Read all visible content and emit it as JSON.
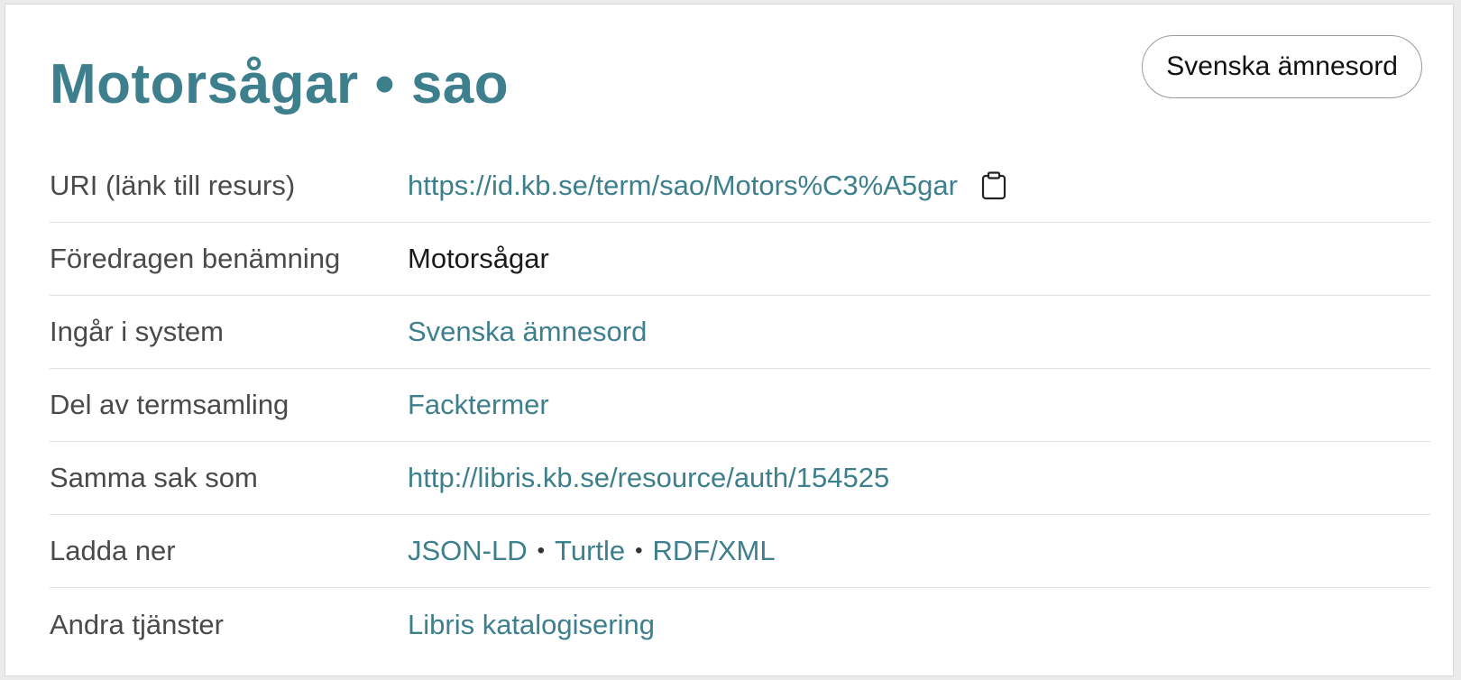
{
  "header": {
    "term": "Motorsågar",
    "separator": "•",
    "code": "sao",
    "scheme_button": "Svenska ämnesord"
  },
  "rows": [
    {
      "label": "URI (länk till resurs)",
      "value": "https://id.kb.se/term/sao/Motors%C3%A5gar",
      "icon": "clipboard-icon"
    },
    {
      "label": "Föredragen benämning",
      "value": "Motorsågar"
    },
    {
      "label": "Ingår i system",
      "value": "Svenska ämnesord"
    },
    {
      "label": "Del av termsamling",
      "value": "Facktermer"
    },
    {
      "label": "Samma sak som",
      "value": "http://libris.kb.se/resource/auth/154525"
    },
    {
      "label": "Ladda ner",
      "links": [
        "JSON-LD",
        "Turtle",
        "RDF/XML"
      ],
      "separator": "•"
    },
    {
      "label": "Andra tjänster",
      "value": "Libris katalogisering"
    }
  ],
  "colors": {
    "accent": "#3d7f8c",
    "label_text": "#4a4a4a",
    "divider": "#e0e0e0"
  }
}
